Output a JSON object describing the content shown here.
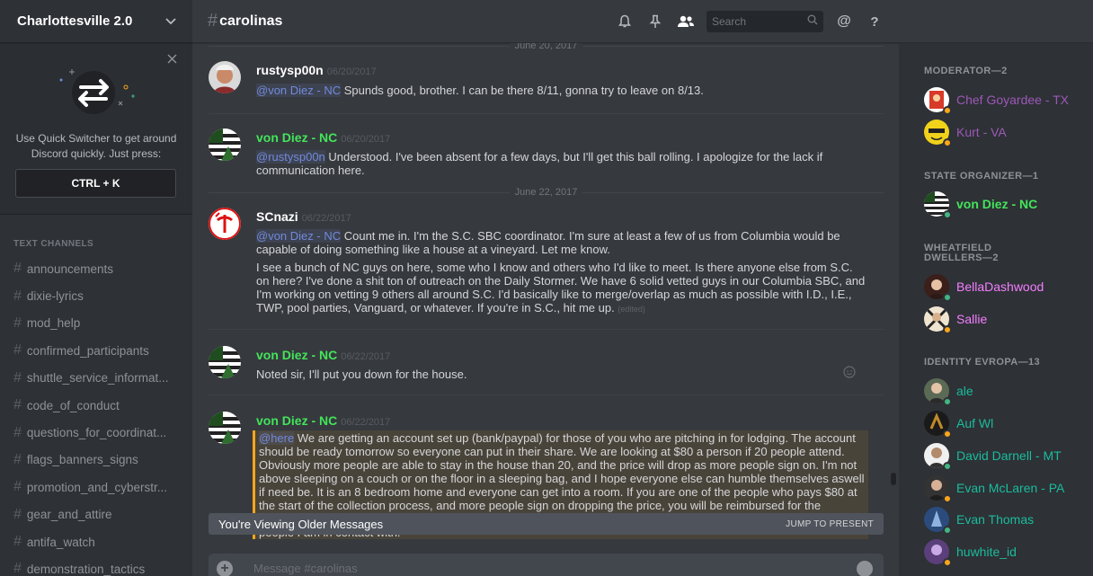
{
  "server": {
    "name": "Charlottesville 2.0"
  },
  "quick_switcher": {
    "text": "Use Quick Switcher to get around Discord quickly. Just press:",
    "shortcut": "CTRL + K"
  },
  "channels": {
    "section_title": "TEXT CHANNELS",
    "items": [
      {
        "label": "announcements"
      },
      {
        "label": "dixie-lyrics"
      },
      {
        "label": "mod_help"
      },
      {
        "label": "confirmed_participants"
      },
      {
        "label": "shuttle_service_informat..."
      },
      {
        "label": "code_of_conduct"
      },
      {
        "label": "questions_for_coordinat..."
      },
      {
        "label": "flags_banners_signs"
      },
      {
        "label": "promotion_and_cyberstr..."
      },
      {
        "label": "gear_and_attire"
      },
      {
        "label": "antifa_watch"
      },
      {
        "label": "demonstration_tactics"
      }
    ]
  },
  "header": {
    "hash": "#",
    "channel": "carolinas",
    "search_placeholder": "Search",
    "at_label": "@",
    "help_label": "?"
  },
  "messages": {
    "divider_top": "June 20, 2017",
    "divider_mid": "June 22, 2017",
    "m1": {
      "author": "rustysp00n",
      "time": "06/20/2017",
      "mention": "@von Diez - NC",
      "text": " Spunds good, brother. I can be there 8/11, gonna try to leave on 8/13."
    },
    "m2": {
      "author": "von Diez - NC",
      "time": "06/20/2017",
      "mention": "@rustysp00n",
      "text": " Understood. I've been absent for a few days, but I'll get this ball rolling. I apologize for the lack if communication here."
    },
    "m3": {
      "author": "SCnazi",
      "time": "06/22/2017",
      "mention": "@von Diez - NC",
      "text": " Count me in. I'm the S.C. SBC coordinator. I'm sure at least a few of us from Columbia would be capable of doing something like a house at a vineyard. Let me know.",
      "text2": "I see a bunch of NC guys on here, some who I know and others who I'd like to meet. Is there anyone else from S.C. on here? I've done a shit ton of outreach on the Daily Stormer. We have 6 solid vetted guys in our Columbia SBC, and I'm working on vetting 9 others all around S.C. I'd basically like to merge/overlap as much as possible with I.D., I.E., TWP, pool parties, Vanguard, or whatever. If you're in S.C., hit me up.",
      "edited": "(edited)"
    },
    "m4": {
      "author": "von Diez - NC",
      "time": "06/22/2017",
      "text": "Noted sir, I'll put you down for the house."
    },
    "m5": {
      "author": "von Diez - NC",
      "time": "06/22/2017",
      "mention": "@here",
      "text": "  We are getting an account set up (bank/paypal) for those of you who are pitching in for lodging. The account should be ready tomorrow so everyone can put in their share. We are looking at $80 a person if 20 people attend. Obviously more people are able to stay in the house than 20, and the price will drop as more people sign on. I'm not above sleeping on a couch or on the floor in a sleeping bag, and I hope everyone else can humble themselves aswell if need be. It is an 8 bedroom home and everyone can get into a room. If you are one of the people who pays $80 at the start of the collection process, and more people sign on dropping the price, you will be reimbursed for the difference. We are starting collections, tomorrow for collections, and I will post the information here and to all the people I am in contact with."
    }
  },
  "older_bar": {
    "text": "You're Viewing Older Messages",
    "jump": "JUMP TO PRESENT"
  },
  "composer": {
    "placeholder": "Message #carolinas",
    "plus": "+"
  },
  "members": {
    "roles": [
      {
        "title": "MODERATOR—2"
      },
      {
        "title": "STATE ORGANIZER—1"
      },
      {
        "title": "WHEATFIELD DWELLERS—2"
      },
      {
        "title": "IDENTITY EVROPA—13"
      }
    ],
    "list": [
      {
        "name": "Chef Goyardee - TX",
        "color": "#9b59b6",
        "status": "idle"
      },
      {
        "name": "Kurt - VA",
        "color": "#9b59b6",
        "status": "idle"
      },
      {
        "name": "von Diez - NC",
        "color": "#43e45a",
        "status": "online"
      },
      {
        "name": "BellaDashwood",
        "color": "#f47fff",
        "status": "online"
      },
      {
        "name": "Sallie",
        "color": "#f47fff",
        "status": "idle"
      },
      {
        "name": "ale",
        "color": "#1abc9c",
        "status": "online"
      },
      {
        "name": "Auf Wl",
        "color": "#1abc9c",
        "status": "idle"
      },
      {
        "name": "David Darnell - MT",
        "color": "#1abc9c",
        "status": "online"
      },
      {
        "name": "Evan McLaren - PA",
        "color": "#1abc9c",
        "status": "idle"
      },
      {
        "name": "Evan Thomas",
        "color": "#1abc9c",
        "status": "online"
      },
      {
        "name": "huwhite_id",
        "color": "#1abc9c",
        "status": "idle"
      }
    ]
  }
}
